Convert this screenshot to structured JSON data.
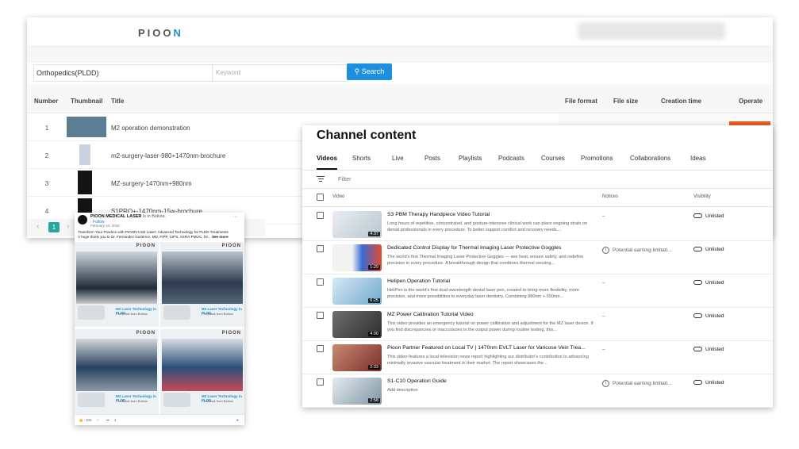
{
  "file_manager": {
    "logo": "PIOON",
    "category_value": "Orthopedics(PLDD)",
    "keyword_placeholder": "Keyword",
    "search_label": "Search",
    "columns": [
      "Number",
      "Thumbnail",
      "Title",
      "File format",
      "File size",
      "Creation time",
      "Operate"
    ],
    "rows": [
      {
        "number": "1",
        "title": "M2 operation demonstration"
      },
      {
        "number": "2",
        "title": "m2-surgery-laser-980+1470nm-brochure"
      },
      {
        "number": "3",
        "title": "MZ-surgery-1470nm+980nm"
      },
      {
        "number": "4",
        "title": "S1PRO+-1470nm-15w-brochure"
      }
    ],
    "pager": {
      "prev": "‹",
      "current": "1",
      "next": "›"
    }
  },
  "facebook_post": {
    "page_name": "PIOON MEDICAL LASER",
    "location": "is in Bolivia.",
    "follow": "· Follow",
    "date": "February 24, 2025 ·",
    "text_line1": "Transform Your Practice with PIOON's M2 Laser: Advanced Technology for PLDD Treatments",
    "text_line2": "A huge thank you to Dr. Fernandez Gutiérrez, MD, FIPP, CIPS, ASRA-PMUC, for...",
    "see_more": "See more",
    "tile_logo": "PIOON",
    "tile_caption1": "M2 Laser Technology in PLDD",
    "tile_caption2": "Feedback from Bolivia",
    "reactions": "106",
    "comments": "4"
  },
  "youtube": {
    "heading": "Channel content",
    "tabs": [
      "Videos",
      "Shorts",
      "Live",
      "Posts",
      "Playlists",
      "Podcasts",
      "Courses",
      "Promotions",
      "Collaborations",
      "Ideas"
    ],
    "filter_placeholder": "Filter",
    "columns": {
      "video": "Video",
      "notices": "Notices",
      "visibility": "Visibility"
    },
    "videos": [
      {
        "title": "S3 PBM Therapy Handpiece Video Tutorial",
        "desc": "Long hours of repetitive, concentrated, and posture-intensive clinical work can place ongoing strain on dental professionals in every procedure. To better support comfort and recovery needs,...",
        "duration": "4:37",
        "notice": "–",
        "notice_icon": false,
        "visibility": "Unlisted"
      },
      {
        "title": "Dedicated Control Display for Thermal Imaging Laser Protective Goggles",
        "desc": "The world's first Thermal Imaging Laser Protective Goggles — see heat, ensure safety, and redefine precision in every procedure. A breakthrough design that combines thermal sensing...",
        "duration": "1:29",
        "notice": "Potential earning limitati...",
        "notice_icon": true,
        "visibility": "Unlisted"
      },
      {
        "title": "Helipen Operation Tutorial",
        "desc": "HeliPen is the world's first dual-wavelength dental laser pen, created to bring more flexibility, more precision, and more possibilities to everyday laser dentistry. Combining 980nm + 650nm...",
        "duration": "6:25",
        "notice": "–",
        "notice_icon": false,
        "visibility": "Unlisted"
      },
      {
        "title": "MZ Power Calibration Tutorial Video",
        "desc": "This video provides an emergency tutorial on power calibration and adjustment for the MZ laser device. If you find discrepancies or inaccuracies in the output power during routine testing, this...",
        "duration": "4:00",
        "notice": "–",
        "notice_icon": false,
        "visibility": "Unlisted"
      },
      {
        "title": "Pioon Partner Featured on Local TV | 1470nm EVLT Laser for Varicose Vein Trea...",
        "desc": "This video features a local television news report highlighting our distributor's contribution to advancing minimally invasive vascular treatment in their market. The report showcases the...",
        "duration": "2:33",
        "notice": "–",
        "notice_icon": false,
        "visibility": "Unlisted"
      },
      {
        "title": "S1-C10 Operation Guide",
        "desc": "Add description",
        "duration": "2:58",
        "notice": "Potential earning limitati...",
        "notice_icon": true,
        "visibility": "Unlisted"
      }
    ]
  }
}
